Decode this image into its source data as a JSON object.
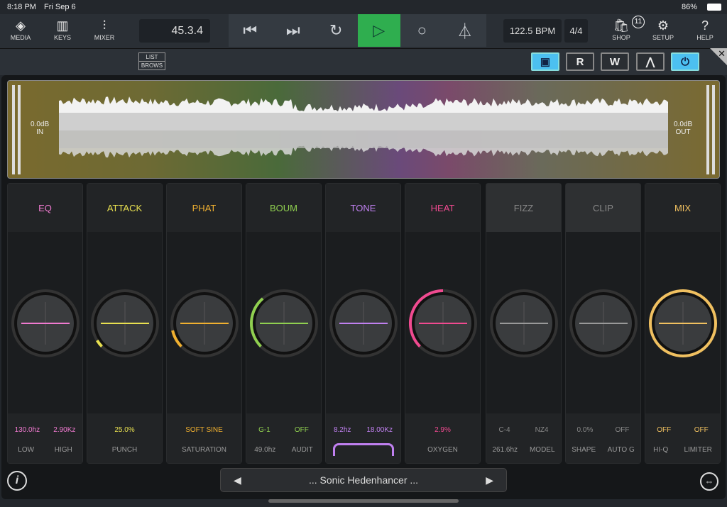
{
  "status": {
    "time": "8:18 PM",
    "date": "Fri Sep 6",
    "battery": "86%"
  },
  "toolbar": {
    "media": "MEDIA",
    "keys": "KEYS",
    "mixer": "MIXER",
    "position": "45.3.4",
    "tempo": "122.5 BPM",
    "signature": "4/4",
    "shop": "SHOP",
    "shop_badge": "11",
    "setup": "SETUP",
    "help": "HELP"
  },
  "transport": {
    "icons": [
      "skip-back-icon",
      "skip-forward-icon",
      "loop-icon",
      "play-icon",
      "record-icon",
      "metronome-icon"
    ],
    "play_color": "#2fae4f"
  },
  "subbar": {
    "list_browse_1": "LIST",
    "list_browse_2": "BROWS",
    "r": "R",
    "w": "W"
  },
  "meter": {
    "in_value": "0.0dB",
    "in_label": "IN",
    "out_value": "0.0dB",
    "out_label": "OUT"
  },
  "modules": [
    {
      "name": "EQ",
      "color": "#f07ad0",
      "vals": [
        "130.0hz",
        "2.90Kz"
      ],
      "labels": [
        "LOW",
        "HIGH"
      ],
      "level": 0
    },
    {
      "name": "ATTACK",
      "color": "#e8e050",
      "vals": [
        "25.0%"
      ],
      "labels": [
        "PUNCH"
      ],
      "level": 0.05
    },
    {
      "name": "PHAT",
      "color": "#f0b030",
      "vals": [
        "SOFT SINE"
      ],
      "labels": [
        "SATURATION"
      ],
      "level": 0.12
    },
    {
      "name": "BOUM",
      "color": "#90d050",
      "vals": [
        "G-1",
        "OFF"
      ],
      "labels": [
        "49.0hz",
        "AUDIT"
      ],
      "level": 0.35
    },
    {
      "name": "TONE",
      "color": "#c080f0",
      "vals": [
        "8.2hz",
        "18.00Kz"
      ],
      "labels": [],
      "level": 0
    },
    {
      "name": "HEAT",
      "color": "#f04a90",
      "vals": [
        "2.9%"
      ],
      "labels": [
        "OXYGEN"
      ],
      "level": 0.5
    },
    {
      "name": "FIZZ",
      "color": "#888888",
      "vals": [
        "C-4",
        "NZ4"
      ],
      "labels": [
        "261.6hz",
        "MODEL"
      ],
      "level": 0
    },
    {
      "name": "CLIP",
      "color": "#888888",
      "vals": [
        "0.0%",
        "OFF"
      ],
      "labels": [
        "SHAPE",
        "AUTO G"
      ],
      "level": 0
    },
    {
      "name": "MIX",
      "color": "#f0c060",
      "vals": [
        "OFF",
        "OFF"
      ],
      "labels": [
        "HI-Q",
        "LIMITER"
      ],
      "level": 1
    }
  ],
  "preset": {
    "name": "... Sonic Hedenhancer ..."
  }
}
